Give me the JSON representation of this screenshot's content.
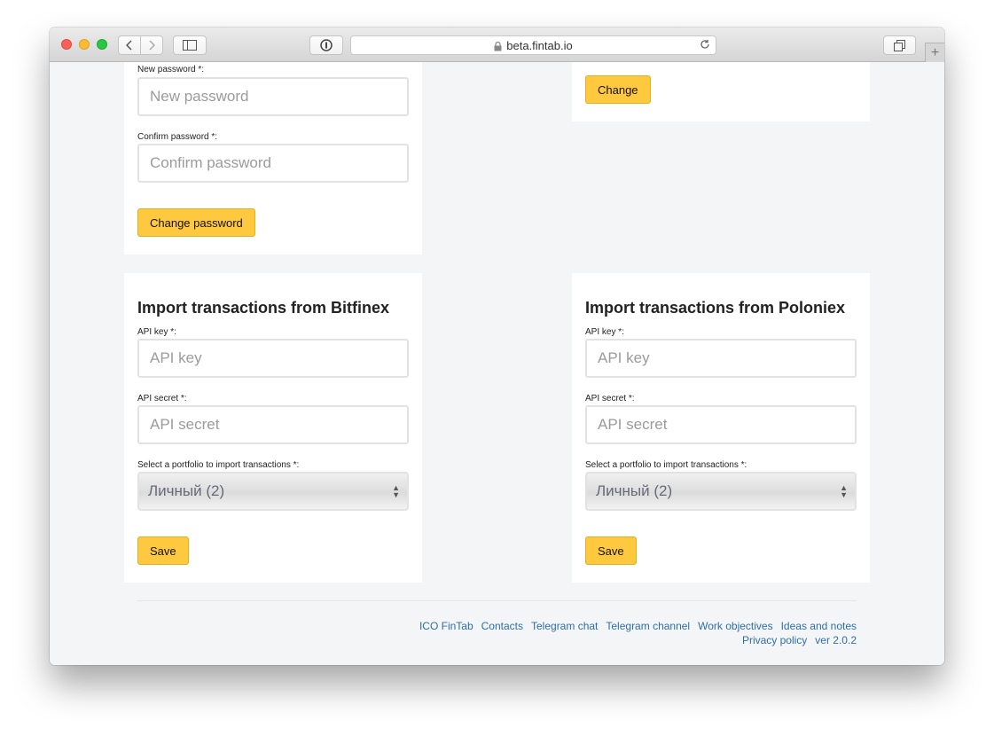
{
  "browser": {
    "url": "beta.fintab.io"
  },
  "password_card": {
    "new_label": "New password *:",
    "new_placeholder": "New password",
    "confirm_label": "Confirm password *:",
    "confirm_placeholder": "Confirm password",
    "submit": "Change password"
  },
  "top_right_card": {
    "submit": "Change"
  },
  "bitfinex": {
    "title": "Import transactions from Bitfinex",
    "api_key_label": "API key *:",
    "api_key_placeholder": "API key",
    "api_secret_label": "API secret *:",
    "api_secret_placeholder": "API secret",
    "portfolio_label": "Select a portfolio to import transactions *:",
    "portfolio_value": "Личный (2)",
    "save": "Save"
  },
  "poloniex": {
    "title": "Import transactions from Poloniex",
    "api_key_label": "API key *:",
    "api_key_placeholder": "API key",
    "api_secret_label": "API secret *:",
    "api_secret_placeholder": "API secret",
    "portfolio_label": "Select a portfolio to import transactions *:",
    "portfolio_value": "Личный (2)",
    "save": "Save"
  },
  "footer": {
    "links_row1": [
      "ICO FinTab",
      "Contacts",
      "Telegram chat",
      "Telegram channel",
      "Work objectives",
      "Ideas and notes"
    ],
    "links_row2": [
      "Privacy policy",
      "ver 2.0.2"
    ]
  },
  "colors": {
    "button_bg": "#fec83f",
    "link": "#2f6ea5"
  }
}
